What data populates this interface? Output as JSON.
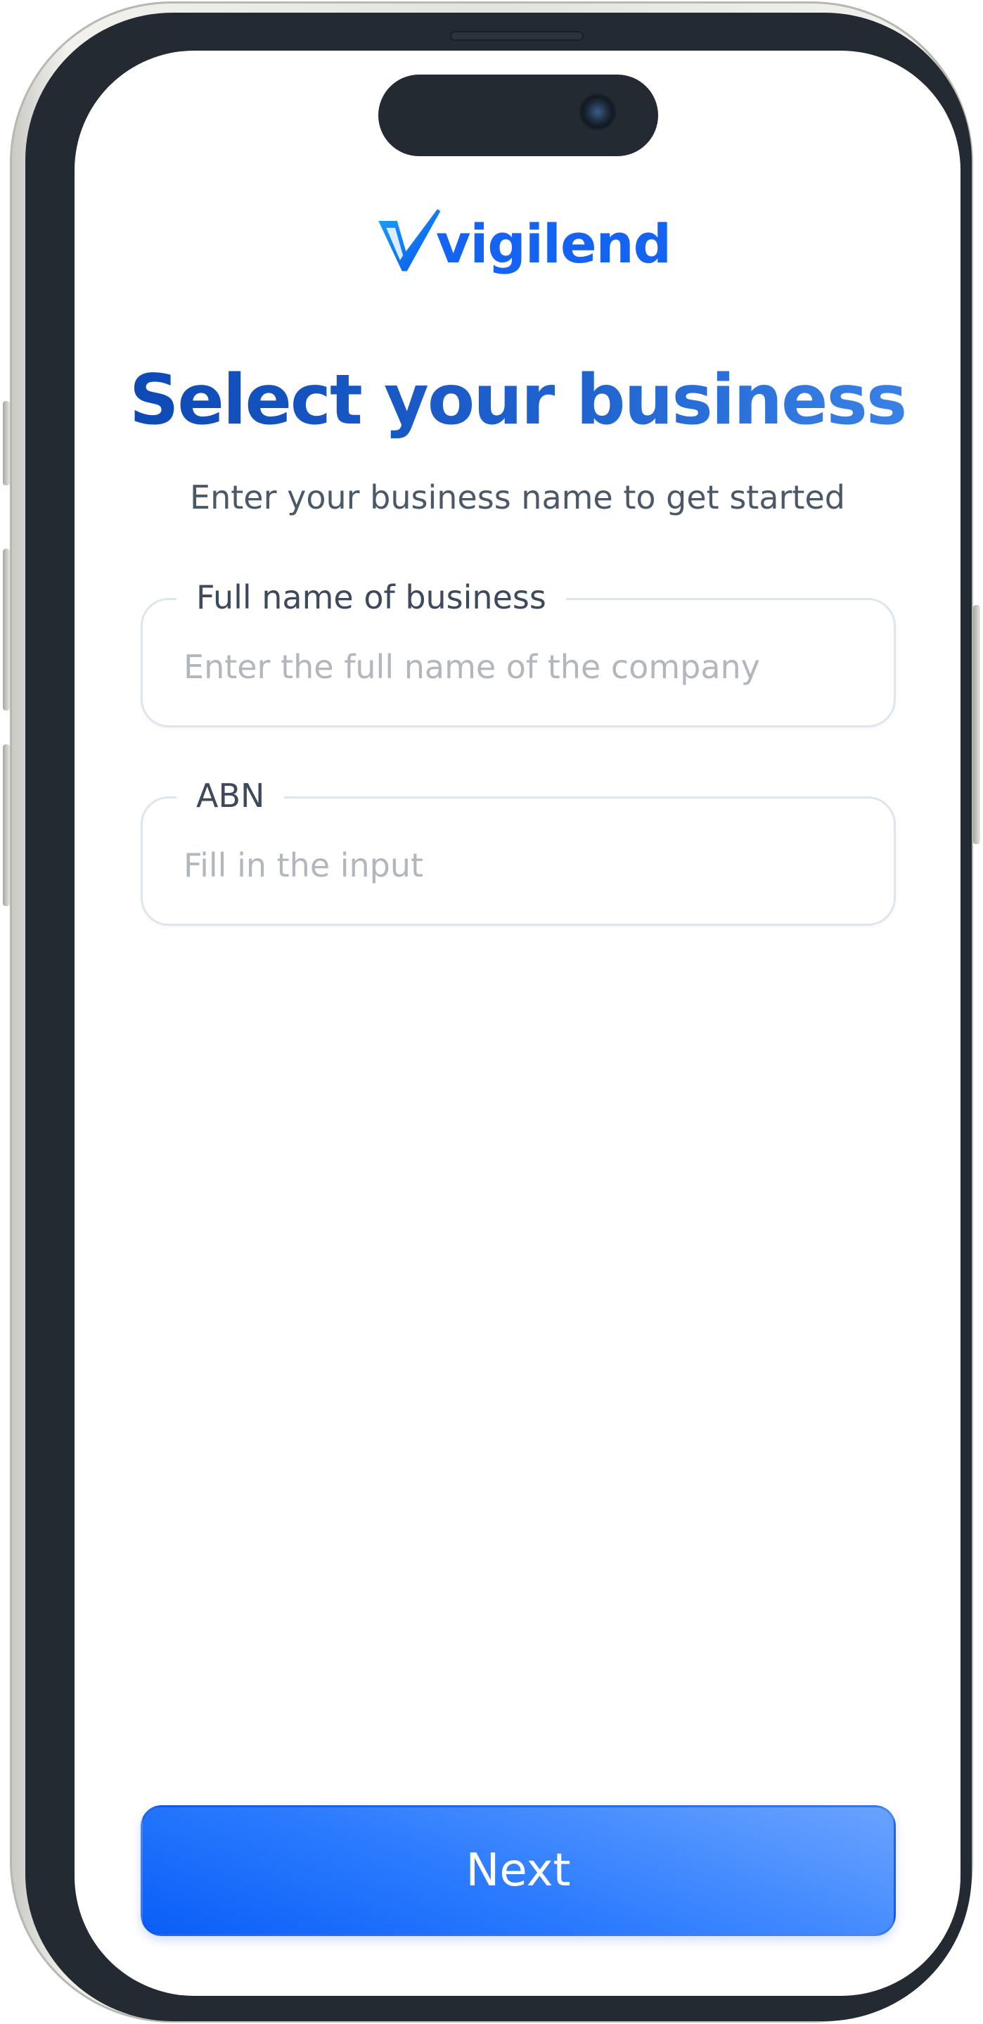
{
  "brand": {
    "name": "vigilend",
    "logo_icon": "v-checkmark-logo",
    "color": "#1463f3"
  },
  "header": {
    "title": "Select your business",
    "subtitle": "Enter your business name to get started"
  },
  "form": {
    "business_name": {
      "label": "Full name of business",
      "placeholder": "Enter the full name of the company",
      "value": ""
    },
    "abn": {
      "label": "ABN",
      "placeholder": "Fill in the input",
      "value": ""
    }
  },
  "actions": {
    "next_label": "Next"
  },
  "colors": {
    "accent": "#1463f3",
    "title_gradient_start": "#0c47b3",
    "title_gradient_end": "#3d86ea",
    "button_gradient_start": "#0a5ef7",
    "button_gradient_end": "#6aa3ff",
    "frame": "#232a31"
  }
}
